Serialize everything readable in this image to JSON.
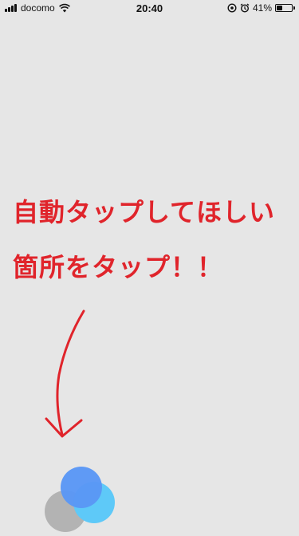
{
  "status_bar": {
    "carrier": "docomo",
    "time": "20:40",
    "battery_percent": "41%",
    "battery_level": 0.41,
    "icons": [
      "signal-icon",
      "wifi-icon",
      "at-icon",
      "alarm-icon",
      "battery-icon"
    ]
  },
  "annotation": {
    "line1": "自動タップしてほしい",
    "line2": "箇所をタップ！！",
    "color": "#e0242b"
  },
  "assistive_touch": {
    "colors": [
      "#b3b3b3",
      "#5ec9f8",
      "#5a97f5"
    ]
  },
  "background_color": "#e6e6e6"
}
